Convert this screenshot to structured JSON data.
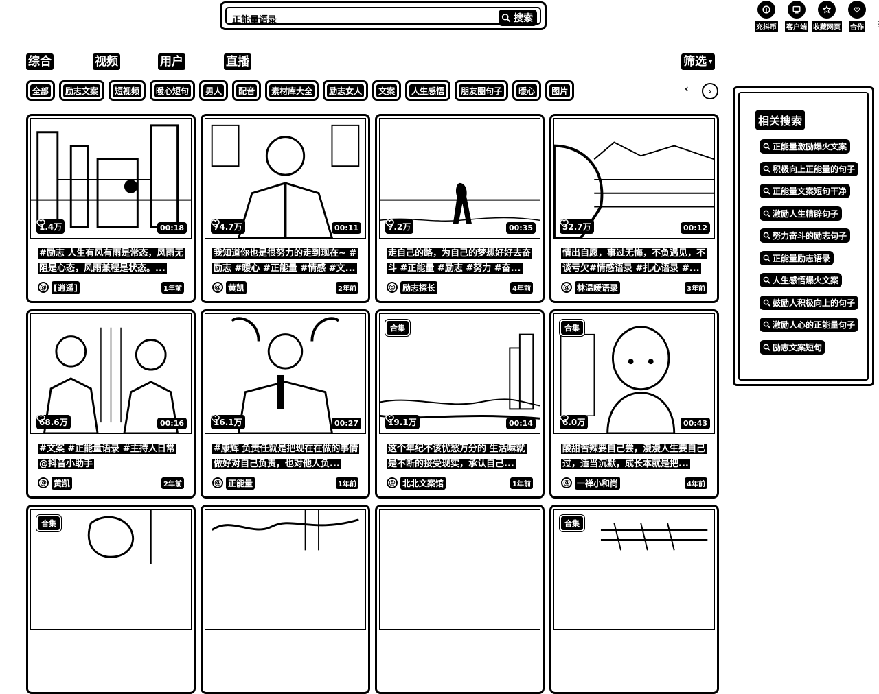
{
  "search": {
    "value": "正能量语录",
    "button_label": "搜索"
  },
  "top_icons": [
    {
      "icon": "coin-icon",
      "label": "充抖币"
    },
    {
      "icon": "client-icon",
      "label": "客户端"
    },
    {
      "icon": "star-icon",
      "label": "收藏网页"
    },
    {
      "icon": "cooperate-icon",
      "label": "合作"
    }
  ],
  "tabs": [
    "综合",
    "视频",
    "用户",
    "直播"
  ],
  "filter_label": "筛选",
  "chips": [
    "全部",
    "励志文案",
    "短视频",
    "暖心短句",
    "男人",
    "配音",
    "素材库大全",
    "励志女人",
    "文案",
    "人生感悟",
    "朋友圈句子",
    "暖心",
    "图片"
  ],
  "cards": [
    {
      "likes": "1.4万",
      "duration": "00:18",
      "badge": "",
      "desc": "#励志 人生有风有雨是常态，风雨无阻是心态，风雨兼程是状态。...",
      "author": "[逍遥]",
      "ago": "1年前"
    },
    {
      "likes": "74.7万",
      "duration": "00:11",
      "badge": "",
      "desc": "我知道你也是很努力的走到现在~ #励志 #暖心 #正能量 #情感 #文...",
      "author": "黄凯",
      "ago": "2年前"
    },
    {
      "likes": "7.2万",
      "duration": "00:35",
      "badge": "",
      "desc": "走自己的路，为自己的梦想好好去奋斗 #正能量 #励志 #努力 #奋...",
      "author": "励志探长",
      "ago": "4年前"
    },
    {
      "likes": "32.7万",
      "duration": "00:12",
      "badge": "",
      "desc": "情出自愿，事过无悔，不负遇见，不谈亏欠#情感语录 #扎心语录 #...",
      "author": "林温暖语录",
      "ago": "3年前"
    },
    {
      "likes": "68.6万",
      "duration": "00:16",
      "badge": "",
      "desc": "#文案 #正能量语录 #主持人日常 @抖音小助手",
      "author": "黄凯",
      "ago": "2年前"
    },
    {
      "likes": "16.1万",
      "duration": "00:27",
      "badge": "",
      "desc": "#康辉 负责任就是把现在在做的事情做好对自己负责，也对他人负...",
      "author": "正能量",
      "ago": "1年前"
    },
    {
      "likes": "19.1万",
      "duration": "00:14",
      "badge": "合集",
      "desc": "这个年纪不该忧愁万分的 生活嘛就是不断的接受现实，承认自己...",
      "author": "北北文案馆",
      "ago": "1年前"
    },
    {
      "likes": "6.0万",
      "duration": "00:43",
      "badge": "合集",
      "desc": "酸甜苦辣要自己尝，漫漫人生要自己过，适当沉默，成长本就是把...",
      "author": "一禅小和尚",
      "ago": "4年前"
    },
    {
      "likes": "",
      "duration": "",
      "badge": "合集",
      "desc": "",
      "author": "",
      "ago": ""
    },
    {
      "likes": "",
      "duration": "",
      "badge": "",
      "desc": "",
      "author": "",
      "ago": ""
    },
    {
      "likes": "",
      "duration": "",
      "badge": "",
      "desc": "",
      "author": "",
      "ago": ""
    },
    {
      "likes": "",
      "duration": "",
      "badge": "合集",
      "desc": "",
      "author": "",
      "ago": ""
    }
  ],
  "related": {
    "title": "相关搜索",
    "items": [
      "正能量激励爆火文案",
      "积极向上正能量的句子",
      "正能量文案短句干净",
      "激励人生精辟句子",
      "努力奋斗的励志句子",
      "正能量励志语录",
      "人生感悟爆火文案",
      "鼓励人积极向上的句子",
      "激励人心的正能量句子",
      "励志文案短句"
    ]
  }
}
